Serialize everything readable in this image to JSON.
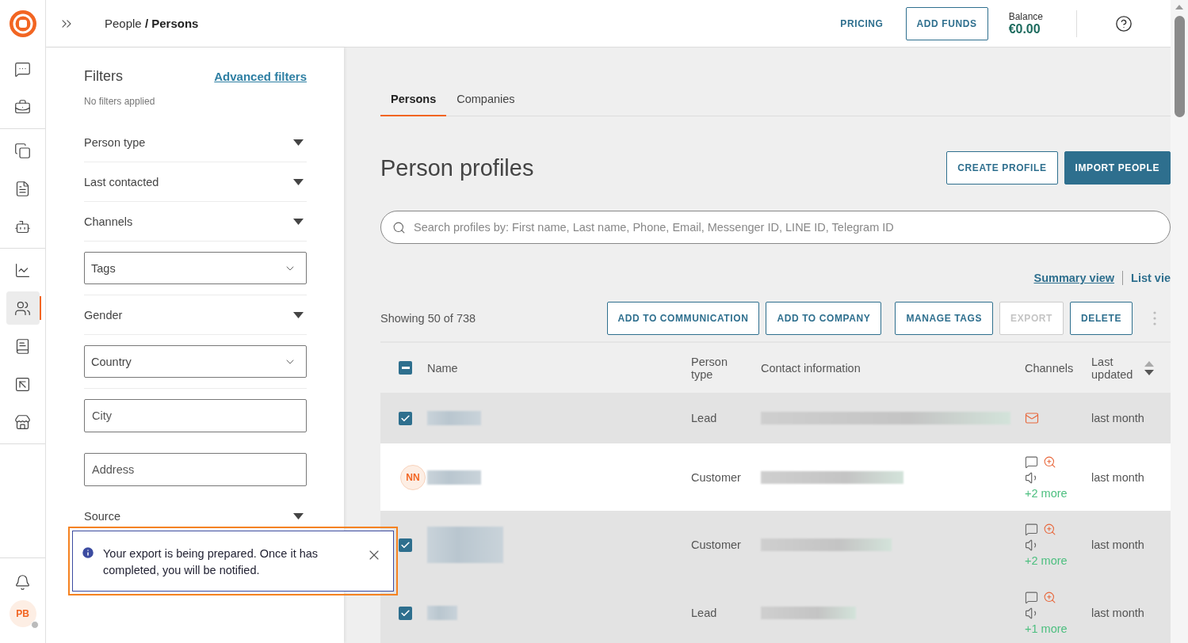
{
  "nav": [
    {
      "selected": false
    },
    {
      "selected": false
    },
    {
      "selected": false
    },
    {
      "selected": false
    },
    {
      "selected": false
    },
    {
      "selected": false
    },
    {
      "selected": true
    },
    {
      "selected": false
    },
    {
      "selected": false
    },
    {
      "selected": false
    }
  ],
  "user": {
    "initials": "PB"
  },
  "breadcrumb": {
    "parent": "People",
    "separator": "/",
    "current": "Persons"
  },
  "topbar": {
    "pricing": "PRICING",
    "add_funds": "ADD FUNDS",
    "balance_label": "Balance",
    "balance": "€0.00"
  },
  "filters": {
    "title": "Filters",
    "advanced": "Advanced filters",
    "status": "No filters applied",
    "items": [
      {
        "kind": "dropdown",
        "label": "Person type"
      },
      {
        "kind": "dropdown",
        "label": "Last contacted"
      },
      {
        "kind": "dropdown",
        "label": "Channels"
      },
      {
        "kind": "select",
        "label": "Tags"
      },
      {
        "kind": "dropdown",
        "label": "Gender"
      },
      {
        "kind": "select",
        "label": "Country"
      },
      {
        "kind": "input",
        "placeholder": "City"
      },
      {
        "kind": "input",
        "placeholder": "Address"
      },
      {
        "kind": "dropdown",
        "label": "Source"
      }
    ]
  },
  "tabs": [
    {
      "label": "Persons",
      "selected": true
    },
    {
      "label": "Companies",
      "selected": false
    }
  ],
  "title": "Person profiles",
  "header_buttons": [
    {
      "label": "CREATE PROFILE",
      "kind": "outline"
    },
    {
      "label": "IMPORT PEOPLE",
      "kind": "solid"
    }
  ],
  "search": {
    "placeholder": "Search profiles by: First name, Last name, Phone, Email, Messenger ID, LINE ID, Telegram ID"
  },
  "views": [
    {
      "label": "Summary view",
      "selected": true
    },
    {
      "label": "List vie",
      "selected": false
    }
  ],
  "showing": "Showing 50 of 738",
  "actions": [
    {
      "label": "ADD TO COMMUNICATION",
      "disabled": false
    },
    {
      "label": "ADD TO COMPANY",
      "disabled": false
    },
    {
      "label": "MANAGE TAGS",
      "disabled": false
    },
    {
      "label": "EXPORT",
      "disabled": true
    },
    {
      "label": "DELETE",
      "disabled": false
    }
  ],
  "table": {
    "select_all_partial": true,
    "columns": [
      "Name",
      "Person type",
      "Contact information",
      "Channels",
      "Last updated"
    ],
    "rows": [
      {
        "selected": true,
        "type": "Lead",
        "updated": "last month"
      },
      {
        "selected": false,
        "avatar": "NN",
        "type": "Customer",
        "more": "+2 more",
        "updated": "last month"
      },
      {
        "selected": true,
        "type": "Customer",
        "more": "+2 more",
        "updated": "last month"
      },
      {
        "selected": true,
        "type": "Lead",
        "more": "+1 more",
        "updated": "last month"
      }
    ]
  },
  "toast": {
    "message": "Your export is being prepared. Once it has completed, you will be notified."
  }
}
